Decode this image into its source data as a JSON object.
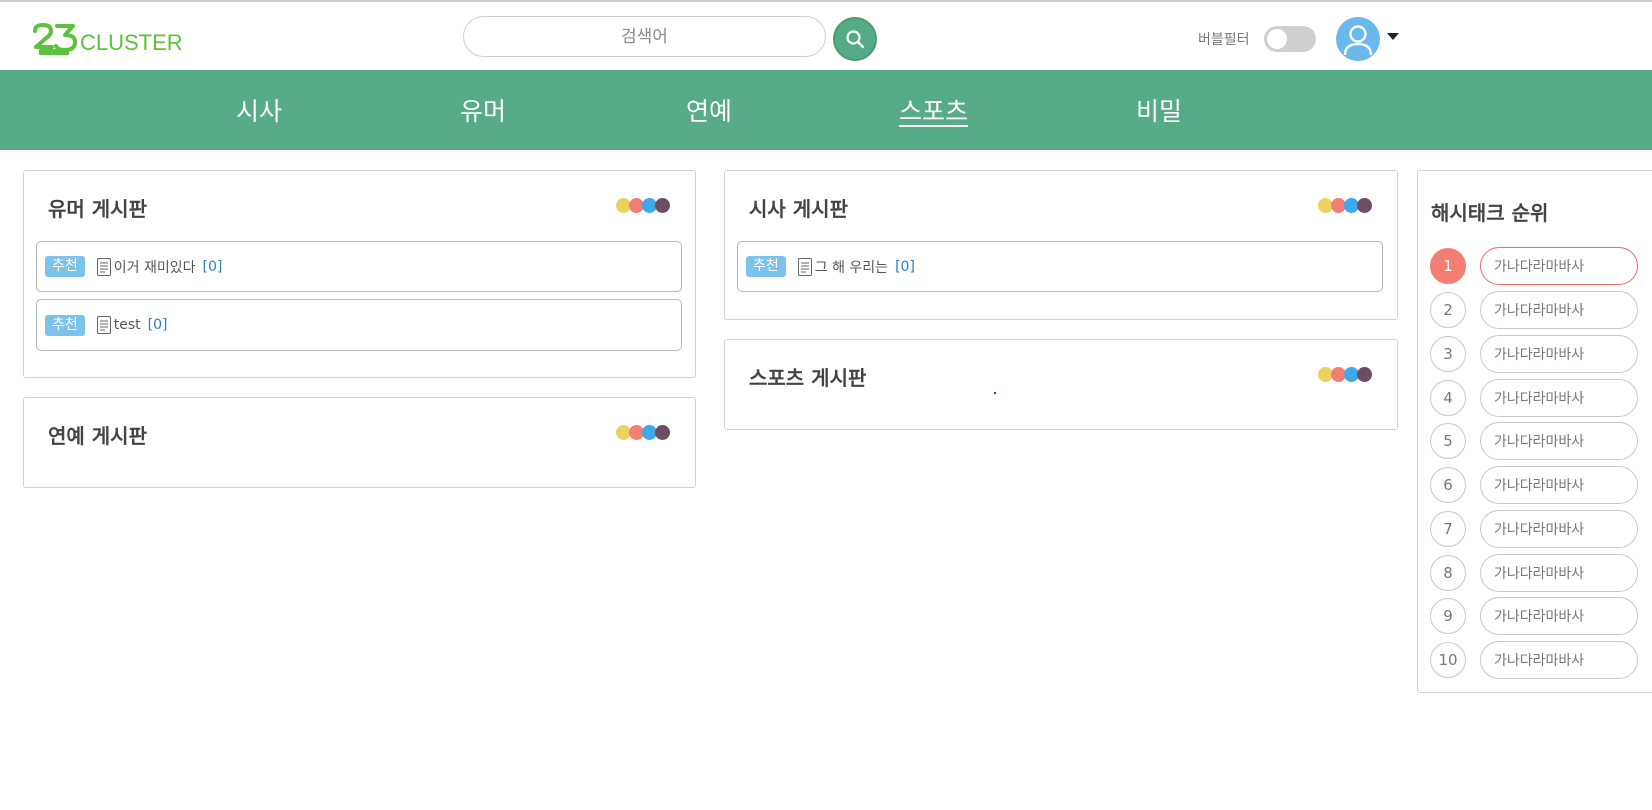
{
  "header": {
    "logo_text": "CLUSTER",
    "logo_mark": "23",
    "search_placeholder": "검색어",
    "bubble_filter_label": "버블필터",
    "bubble_filter_on": false
  },
  "nav": {
    "items": [
      {
        "label": "시사",
        "active": false
      },
      {
        "label": "유머",
        "active": false
      },
      {
        "label": "연예",
        "active": false
      },
      {
        "label": "스포츠",
        "active": true
      },
      {
        "label": "비밀",
        "active": false
      }
    ]
  },
  "colors": {
    "brand_green": "#57ab89",
    "logo_green": "#5cc23b",
    "badge_blue": "#7cc3ec",
    "count_blue": "#2f7dc5",
    "rank_top": "#f47e73",
    "dots": [
      "#ecd15e",
      "#f47e73",
      "#3ea9e8",
      "#6b4e63"
    ]
  },
  "boards": {
    "humor": {
      "title": "유머 게시판",
      "posts": [
        {
          "badge": "추천",
          "title": "이거 재미있다",
          "count": "[0]"
        },
        {
          "badge": "추천",
          "title": "test",
          "count": "[0]"
        }
      ]
    },
    "entertainment": {
      "title": "연예 게시판",
      "posts": []
    },
    "current_affairs": {
      "title": "시사 게시판",
      "posts": [
        {
          "badge": "추천",
          "title": "그 해 우리는",
          "count": "[0]"
        }
      ]
    },
    "sports": {
      "title": "스포츠 게시판",
      "posts": []
    }
  },
  "hashtag_ranking": {
    "title": "해시태크 순위",
    "items": [
      {
        "rank": "1",
        "tag": "가나다라마바사"
      },
      {
        "rank": "2",
        "tag": "가나다라마바사"
      },
      {
        "rank": "3",
        "tag": "가나다라마바사"
      },
      {
        "rank": "4",
        "tag": "가나다라마바사"
      },
      {
        "rank": "5",
        "tag": "가나다라마바사"
      },
      {
        "rank": "6",
        "tag": "가나다라마바사"
      },
      {
        "rank": "7",
        "tag": "가나다라마바사"
      },
      {
        "rank": "8",
        "tag": "가나다라마바사"
      },
      {
        "rank": "9",
        "tag": "가나다라마바사"
      },
      {
        "rank": "10",
        "tag": "가나다라마바사"
      }
    ]
  },
  "icons": {
    "search": "search-icon",
    "avatar": "user-avatar-icon",
    "caret": "caret-down-icon",
    "post": "document-icon"
  }
}
